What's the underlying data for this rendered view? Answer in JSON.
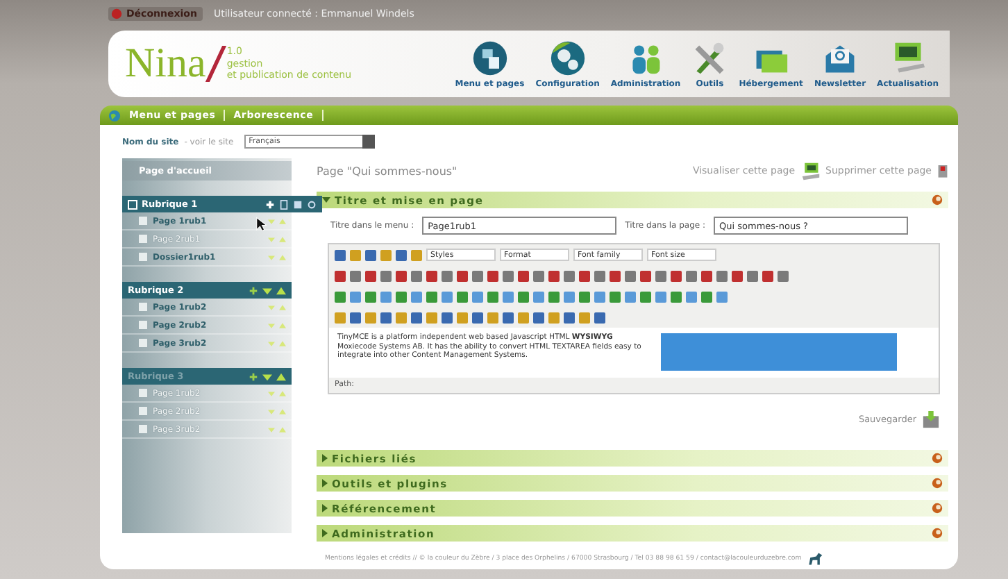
{
  "top_bar": {
    "logout": "Déconnexion",
    "user": "Utilisateur connecté : Emmanuel Windels"
  },
  "header": {
    "logo": "Nina",
    "version": "1.0",
    "tagline_1": "gestion",
    "tagline_2": "et publication de contenu",
    "nav": [
      {
        "label": "Menu et pages",
        "kind": "pages"
      },
      {
        "label": "Configuration",
        "kind": "config"
      },
      {
        "label": "Administration",
        "kind": "users"
      },
      {
        "label": "Outils",
        "kind": "tools"
      },
      {
        "label": "Hébergement",
        "kind": "folders"
      },
      {
        "label": "Newsletter",
        "kind": "mail"
      },
      {
        "label": "Actualisation",
        "kind": "monitor"
      }
    ]
  },
  "breadcrumb": [
    "Menu et pages",
    "Arborescence"
  ],
  "site": {
    "label": "Nom du site",
    "link": "- voir le site",
    "language": "Français"
  },
  "tree": {
    "home": "Page d'accueil",
    "groups": [
      {
        "title": "Rubrique 1",
        "selected": true,
        "disabled": false,
        "items": [
          {
            "label": "Page 1rub1",
            "disabled": false
          },
          {
            "label": "Page 2rub1",
            "disabled": true
          },
          {
            "label": "Dossier1rub1",
            "disabled": false
          }
        ]
      },
      {
        "title": "Rubrique 2",
        "selected": false,
        "disabled": false,
        "items": [
          {
            "label": "Page 1rub2",
            "disabled": false
          },
          {
            "label": "Page 2rub2",
            "disabled": false
          },
          {
            "label": "Page 3rub2",
            "disabled": false
          }
        ]
      },
      {
        "title": "Rubrique 3",
        "selected": false,
        "disabled": true,
        "items": [
          {
            "label": "Page 1rub2",
            "disabled": true
          },
          {
            "label": "Page 2rub2",
            "disabled": true
          },
          {
            "label": "Page 3rub2",
            "disabled": true
          }
        ]
      }
    ]
  },
  "page": {
    "title": "Page \"Qui sommes-nous\"",
    "view": "Visualiser cette page",
    "delete": "Supprimer cette page"
  },
  "sections": [
    {
      "title": "Titre et mise en page",
      "expanded": true
    },
    {
      "title": "Fichiers liés",
      "expanded": false
    },
    {
      "title": "Outils et plugins",
      "expanded": false
    },
    {
      "title": "Référencement",
      "expanded": false
    },
    {
      "title": "Administration",
      "expanded": false
    }
  ],
  "form": {
    "fields": [
      {
        "label": "Titre dans le menu :",
        "value": "Page1rub1"
      },
      {
        "label": "Titre dans la page :",
        "value": "Qui sommes-nous ?"
      }
    ],
    "editor": {
      "dropdowns": [
        "Styles",
        "Format",
        "Font family",
        "Font size"
      ],
      "content": "TinyMCE is a platform independent web based Javascript HTML **WYSIWYG** Moxiecode Systems AB. It has the ability to convert HTML TEXTAREA fields easy to integrate into other Content Management Systems.",
      "path": "Path:"
    },
    "save": "Sauvegarder"
  },
  "footer": "Mentions légales et crédits // © la couleur du Zèbre / 3 place des Orphelins / 67000 Strasbourg / Tel 03 88 98 61 59 / contact@lacouleurduzebre.com"
}
